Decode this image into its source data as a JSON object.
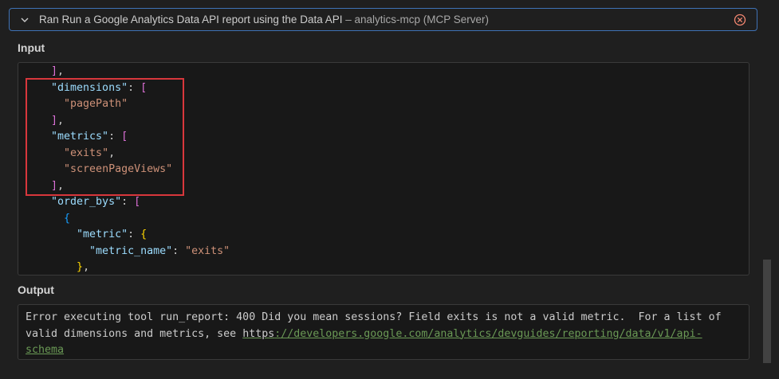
{
  "header": {
    "title": "Ran Run a Google Analytics Data API report using the Data API",
    "subtitle": " – analytics-mcp (MCP Server)"
  },
  "input": {
    "label": "Input",
    "code_lines": [
      [
        {
          "t": "p",
          "v": "  "
        },
        {
          "t": "b1",
          "v": "]"
        },
        {
          "t": "p",
          "v": ","
        }
      ],
      [
        {
          "t": "p",
          "v": "  "
        },
        {
          "t": "k",
          "v": "\"dimensions\""
        },
        {
          "t": "p",
          "v": ": "
        },
        {
          "t": "b1",
          "v": "["
        }
      ],
      [
        {
          "t": "p",
          "v": "    "
        },
        {
          "t": "s",
          "v": "\"pagePath\""
        }
      ],
      [
        {
          "t": "p",
          "v": "  "
        },
        {
          "t": "b1",
          "v": "]"
        },
        {
          "t": "p",
          "v": ","
        }
      ],
      [
        {
          "t": "p",
          "v": "  "
        },
        {
          "t": "k",
          "v": "\"metrics\""
        },
        {
          "t": "p",
          "v": ": "
        },
        {
          "t": "b1",
          "v": "["
        }
      ],
      [
        {
          "t": "p",
          "v": "    "
        },
        {
          "t": "s",
          "v": "\"exits\""
        },
        {
          "t": "p",
          "v": ","
        }
      ],
      [
        {
          "t": "p",
          "v": "    "
        },
        {
          "t": "s",
          "v": "\"screenPageViews\""
        }
      ],
      [
        {
          "t": "p",
          "v": "  "
        },
        {
          "t": "b1",
          "v": "]"
        },
        {
          "t": "p",
          "v": ","
        }
      ],
      [
        {
          "t": "p",
          "v": "  "
        },
        {
          "t": "k",
          "v": "\"order_bys\""
        },
        {
          "t": "p",
          "v": ": "
        },
        {
          "t": "b1",
          "v": "["
        }
      ],
      [
        {
          "t": "p",
          "v": "    "
        },
        {
          "t": "b2",
          "v": "{"
        }
      ],
      [
        {
          "t": "p",
          "v": "      "
        },
        {
          "t": "k",
          "v": "\"metric\""
        },
        {
          "t": "p",
          "v": ": "
        },
        {
          "t": "b3",
          "v": "{"
        }
      ],
      [
        {
          "t": "p",
          "v": "        "
        },
        {
          "t": "k",
          "v": "\"metric_name\""
        },
        {
          "t": "p",
          "v": ": "
        },
        {
          "t": "s",
          "v": "\"exits\""
        }
      ],
      [
        {
          "t": "p",
          "v": "      "
        },
        {
          "t": "b3",
          "v": "}"
        },
        {
          "t": "p",
          "v": ","
        }
      ]
    ]
  },
  "output": {
    "label": "Output",
    "text_before": "Error executing tool run_report: 400 Did you mean sessions? Field exits is not a valid metric.  For a list of valid dimensions and metrics, see ",
    "link_scheme": "https",
    "link_rest": "://developers.google.com/analytics/devguides/reporting/data/v1/api-schema"
  },
  "icons": {
    "chevron": "chevron-down-icon",
    "close": "close-circle-icon"
  },
  "colors": {
    "accent_border": "#3f72b5",
    "highlight_border": "#d8373c",
    "close_icon": "#f48771"
  }
}
